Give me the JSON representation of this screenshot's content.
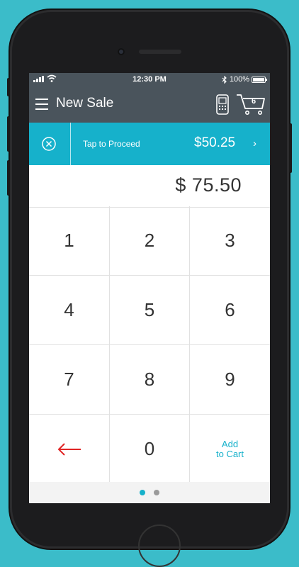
{
  "status_bar": {
    "time": "12:30 PM",
    "battery_text": "100%"
  },
  "navbar": {
    "title": "New Sale",
    "cart_count": "6"
  },
  "proceed_bar": {
    "label": "Tap to Proceed",
    "amount": "$50.25",
    "chevron": "›"
  },
  "display": {
    "amount": "$ 75.50"
  },
  "keypad": {
    "keys": [
      "1",
      "2",
      "3",
      "4",
      "5",
      "6",
      "7",
      "8",
      "9"
    ],
    "zero": "0",
    "add_line1": "Add",
    "add_line2": "to Cart"
  },
  "pager": {
    "active_index": 0,
    "count": 2
  },
  "colors": {
    "accent": "#16b1cb",
    "nav_bg": "#4a545c",
    "backspace": "#e02424",
    "background": "#3bbcc9",
    "dot_active": "#16b1cb",
    "dot_inactive": "#9a9a9a"
  },
  "icons": {
    "menu": "hamburger-icon",
    "card_reader": "card-reader-icon",
    "cart": "cart-icon",
    "cancel": "cancel-circle-icon",
    "backspace": "arrow-left-icon"
  }
}
